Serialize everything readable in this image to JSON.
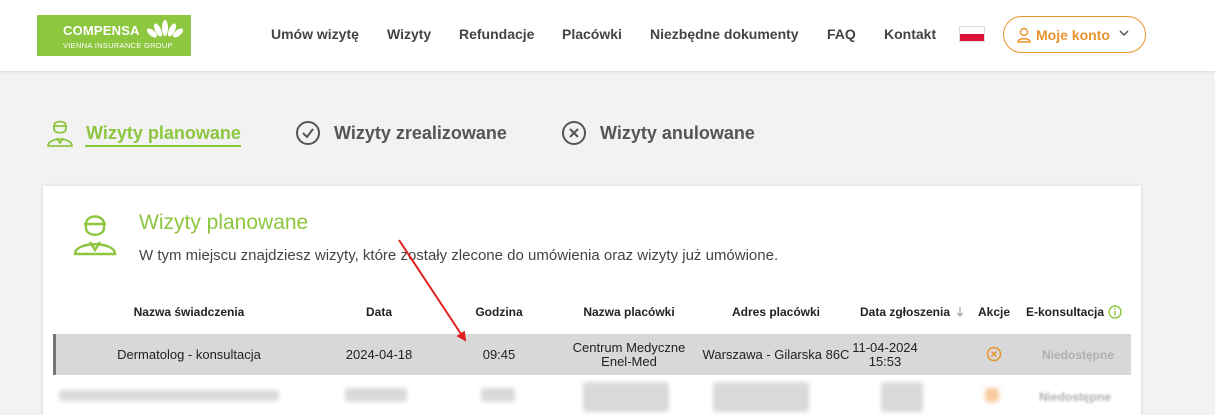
{
  "logo": {
    "brand": "COMPENSA",
    "sub": "VIENNA INSURANCE GROUP"
  },
  "nav": [
    {
      "label": "Umów wizytę"
    },
    {
      "label": "Wizyty"
    },
    {
      "label": "Refundacje"
    },
    {
      "label": "Placówki"
    },
    {
      "label": "Niezbędne dokumenty"
    },
    {
      "label": "FAQ"
    },
    {
      "label": "Kontakt"
    }
  ],
  "account": {
    "label": "Moje konto"
  },
  "tabs": [
    {
      "label": "Wizyty planowane"
    },
    {
      "label": "Wizyty zrealizowane"
    },
    {
      "label": "Wizyty anulowane"
    }
  ],
  "section": {
    "title": "Wizyty planowane",
    "description": "W tym miejscu znajdziesz wizyty, które zostały zlecone do umówienia oraz wizyty już umówione."
  },
  "table": {
    "headers": [
      "Nazwa świadczenia",
      "Data",
      "Godzina",
      "Nazwa placówki",
      "Adres placówki",
      "Data zgłoszenia",
      "Akcje",
      "E-konsultacja"
    ],
    "row": {
      "service": "Dermatolog - konsultacja",
      "date": "2024-04-18",
      "time": "09:45",
      "facility_line1": "Centrum Medyczne",
      "facility_line2": "Enel-Med",
      "address": "Warszawa - Gilarska 86C",
      "submitted_date": "11-04-2024",
      "submitted_time": "15:53",
      "econsult": "Niedostępne"
    },
    "blurred_row": {
      "econsult": "Niedostępne"
    }
  },
  "colors": {
    "brand_green": "#8dc63f",
    "accent_orange": "#e8932c",
    "flag_red": "#dc143c"
  }
}
